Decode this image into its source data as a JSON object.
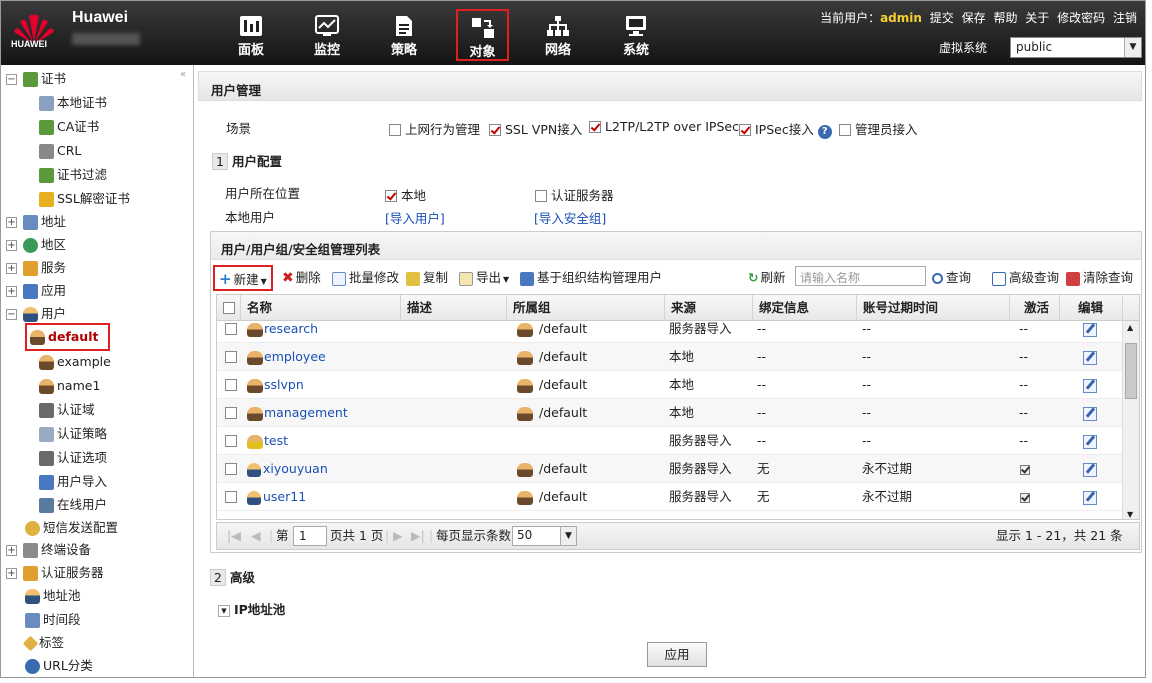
{
  "brand": {
    "logo_text": "HUAWEI",
    "name": "Huawei"
  },
  "nav": [
    {
      "label": "面板"
    },
    {
      "label": "监控"
    },
    {
      "label": "策略"
    },
    {
      "label": "对象"
    },
    {
      "label": "网络"
    },
    {
      "label": "系统"
    }
  ],
  "header": {
    "current_user_label": "当前用户：",
    "current_user": "admin",
    "links": [
      "提交",
      "保存",
      "帮助",
      "关于",
      "修改密码",
      "注销"
    ],
    "vsys_label": "虚拟系统",
    "vsys_value": "public"
  },
  "sidebar": {
    "collapse_glyph": "«",
    "items": [
      {
        "label": "证书",
        "expand": "−"
      },
      {
        "label": "本地证书"
      },
      {
        "label": "CA证书"
      },
      {
        "label": "CRL"
      },
      {
        "label": "证书过滤"
      },
      {
        "label": "SSL解密证书"
      },
      {
        "label": "地址",
        "expand": "+"
      },
      {
        "label": "地区",
        "expand": "+"
      },
      {
        "label": "服务",
        "expand": "+"
      },
      {
        "label": "应用",
        "expand": "+"
      },
      {
        "label": "用户",
        "expand": "−"
      },
      {
        "label": "default"
      },
      {
        "label": "example"
      },
      {
        "label": "name1"
      },
      {
        "label": "认证域"
      },
      {
        "label": "认证策略"
      },
      {
        "label": "认证选项"
      },
      {
        "label": "用户导入"
      },
      {
        "label": "在线用户"
      },
      {
        "label": "短信发送配置"
      },
      {
        "label": "终端设备",
        "expand": "+"
      },
      {
        "label": "认证服务器",
        "expand": "+"
      },
      {
        "label": "地址池"
      },
      {
        "label": "时间段"
      },
      {
        "label": "标签"
      },
      {
        "label": "URL分类"
      }
    ]
  },
  "main": {
    "title": "用户管理",
    "scene_label": "场景",
    "scenes": [
      {
        "label": "上网行为管理",
        "checked": false
      },
      {
        "label": "SSL VPN接入",
        "checked": true
      },
      {
        "label": "L2TP/L2TP over IPSec",
        "checked": true
      },
      {
        "label": "IPSec接入",
        "checked": true
      },
      {
        "label": "管理员接入",
        "checked": false
      }
    ],
    "help_glyph": "?",
    "section1": {
      "num": "1",
      "title": "用户配置"
    },
    "location_label": "用户所在位置",
    "loc_local": "本地",
    "loc_auth": "认证服务器",
    "local_user_label": "本地用户",
    "import_users": "[导入用户]",
    "import_groups": "[导入安全组]",
    "list_title": "用户/用户组/安全组管理列表",
    "toolbar": {
      "new": "新建",
      "delete": "删除",
      "batch": "批量修改",
      "copy": "复制",
      "export": "导出",
      "org": "基于组织结构管理用户",
      "refresh": "刷新",
      "search_placeholder": "请输入名称",
      "search": "查询",
      "advanced": "高级查询",
      "clear": "清除查询"
    },
    "columns": [
      "名称",
      "描述",
      "所属组",
      "来源",
      "绑定信息",
      "账号过期时间",
      "激活",
      "编辑"
    ],
    "rows": [
      {
        "name": "research",
        "desc": "",
        "group": "/default",
        "source": "服务器导入",
        "bind": "--",
        "expire": "--",
        "active": "--"
      },
      {
        "name": "employee",
        "desc": "",
        "group": "/default",
        "source": "本地",
        "bind": "--",
        "expire": "--",
        "active": "--"
      },
      {
        "name": "sslvpn",
        "desc": "",
        "group": "/default",
        "source": "本地",
        "bind": "--",
        "expire": "--",
        "active": "--"
      },
      {
        "name": "management",
        "desc": "",
        "group": "/default",
        "source": "本地",
        "bind": "--",
        "expire": "--",
        "active": "--"
      },
      {
        "name": "test",
        "desc": "",
        "group": "",
        "source": "服务器导入",
        "bind": "--",
        "expire": "--",
        "active": "--"
      },
      {
        "name": "xiyouyuan",
        "desc": "",
        "group": "/default",
        "source": "服务器导入",
        "bind": "无",
        "expire": "永不过期",
        "active": "checked"
      },
      {
        "name": "user11",
        "desc": "",
        "group": "/default",
        "source": "服务器导入",
        "bind": "无",
        "expire": "永不过期",
        "active": "checked"
      }
    ],
    "pager": {
      "page_prefix": "第",
      "page_value": "1",
      "page_suffix": "页共 1 页",
      "per_page_label": "每页显示条数",
      "per_page_value": "50",
      "display": "显示 1 - 21，共 21 条"
    },
    "section2": {
      "num": "2",
      "title": "高级"
    },
    "ip_pool": "IP地址池",
    "apply": "应用"
  },
  "colors": {
    "highlight": "#e02020",
    "link": "#1a4fb5",
    "admin": "#f2d030"
  }
}
